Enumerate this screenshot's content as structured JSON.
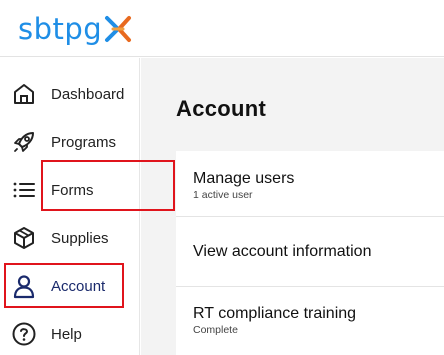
{
  "brand": {
    "logo_text": "sbtpg",
    "logo_mark_color": "#e86a1f",
    "logo_text_color": "#1f8ee6"
  },
  "sidebar": {
    "items": [
      {
        "label": "Dashboard",
        "icon": "home-icon"
      },
      {
        "label": "Programs",
        "icon": "rocket-icon"
      },
      {
        "label": "Forms",
        "icon": "list-icon"
      },
      {
        "label": "Supplies",
        "icon": "box-icon"
      },
      {
        "label": "Account",
        "icon": "user-icon",
        "active": true
      },
      {
        "label": "Help",
        "icon": "help-icon"
      }
    ]
  },
  "main": {
    "title": "Account",
    "rows": [
      {
        "title": "Manage users",
        "subtitle": "1 active user"
      },
      {
        "title": "View account information",
        "subtitle": ""
      },
      {
        "title": "RT compliance training",
        "subtitle": "Complete"
      }
    ]
  },
  "colors": {
    "highlight": "#e0141c",
    "active_text": "#1a2a6c",
    "background": "#f3f3f3"
  }
}
